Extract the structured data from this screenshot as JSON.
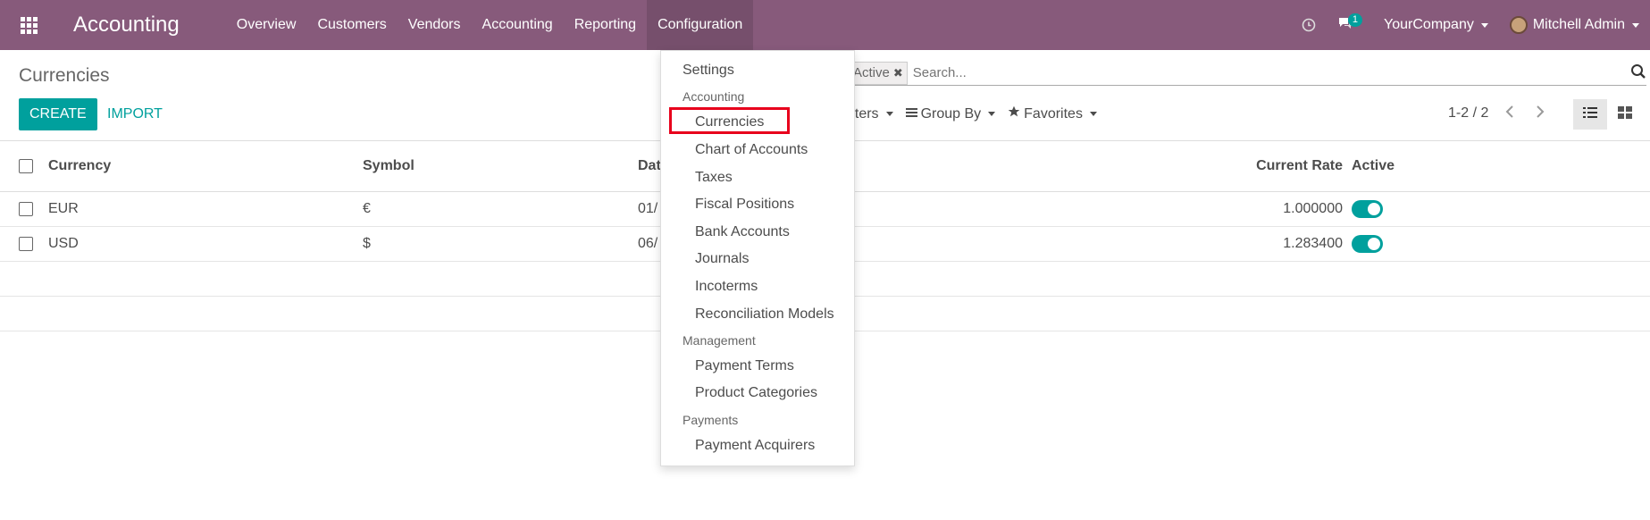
{
  "app": {
    "title": "Accounting",
    "menu": [
      "Overview",
      "Customers",
      "Vendors",
      "Accounting",
      "Reporting",
      "Configuration"
    ],
    "active_menu": "Configuration"
  },
  "systray": {
    "messages_count": "1",
    "company": "YourCompany",
    "user": "Mitchell Admin"
  },
  "control_panel": {
    "breadcrumb": "Currencies",
    "create_label": "CREATE",
    "import_label": "IMPORT",
    "facet_label": "Active",
    "search_placeholder": "Search...",
    "filters_label": "Filters",
    "group_by_label": "Group By",
    "favorites_label": "Favorites",
    "pager": "1-2 / 2"
  },
  "table": {
    "headers": {
      "currency": "Currency",
      "symbol": "Symbol",
      "date": "Date",
      "current_rate": "Current Rate",
      "active": "Active"
    },
    "rows": [
      {
        "currency": "EUR",
        "symbol": "€",
        "date": "01/",
        "rate": "1.000000",
        "active": true
      },
      {
        "currency": "USD",
        "symbol": "$",
        "date": "06/",
        "rate": "1.283400",
        "active": true
      }
    ]
  },
  "dropdown": {
    "settings": "Settings",
    "section_accounting": "Accounting",
    "currencies": "Currencies",
    "chart_of_accounts": "Chart of Accounts",
    "taxes": "Taxes",
    "fiscal_positions": "Fiscal Positions",
    "bank_accounts": "Bank Accounts",
    "journals": "Journals",
    "incoterms": "Incoterms",
    "reconciliation_models": "Reconciliation Models",
    "section_management": "Management",
    "payment_terms": "Payment Terms",
    "product_categories": "Product Categories",
    "section_payments": "Payments",
    "payment_acquirers": "Payment Acquirers",
    "highlighted_item": "Currencies"
  },
  "colors": {
    "navbar": "#875a7b",
    "accent": "#00a09d",
    "highlight": "#e8001c"
  }
}
